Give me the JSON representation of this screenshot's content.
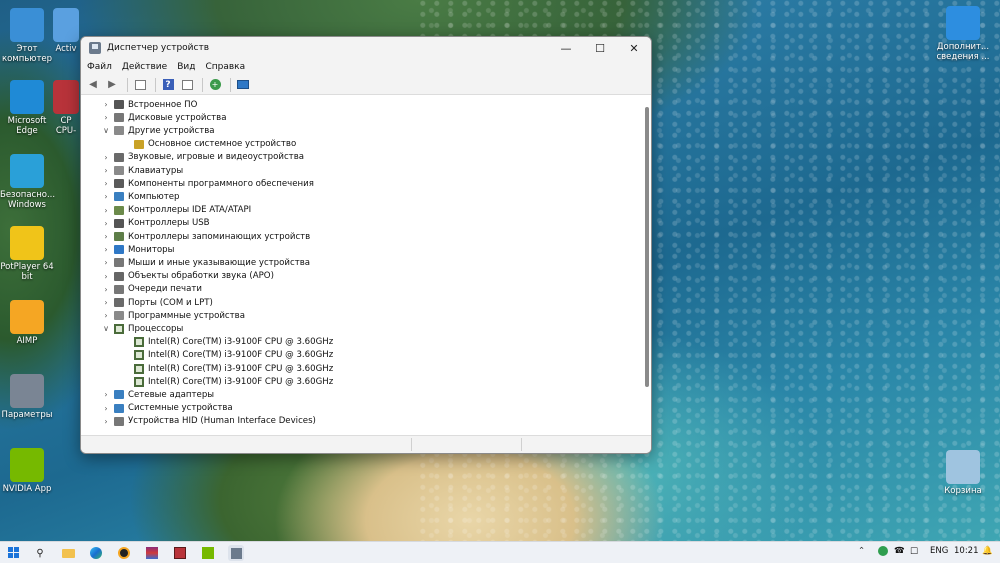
{
  "desktop": {
    "icons_left": [
      {
        "label": "Этот компьютер",
        "icon": "monitor-icon",
        "color": "#3a8fd6"
      },
      {
        "label": "Microsoft Edge",
        "icon": "edge-icon",
        "color": "#1f8ad6"
      },
      {
        "label": "Безопасно... Windows",
        "icon": "shield-icon",
        "color": "#2aa0d8"
      },
      {
        "label": "PotPlayer 64 bit",
        "icon": "potplayer-icon",
        "color": "#f0c419"
      },
      {
        "label": "AIMP",
        "icon": "aimp-icon",
        "color": "#f5a623"
      },
      {
        "label": "Параметры",
        "icon": "gear-icon",
        "color": "#7a8594"
      },
      {
        "label": "NVIDIA App",
        "icon": "nvidia-icon",
        "color": "#76b900"
      }
    ],
    "icons_col2": [
      {
        "label": "Activ",
        "icon": "key-icon"
      },
      {
        "label": "CP CPU-",
        "icon": "cpuz-icon"
      }
    ],
    "icons_right": [
      {
        "label": "Дополнит... сведения ...",
        "icon": "info-image-icon",
        "color": "#2d8ee0"
      },
      {
        "label": "Корзина",
        "icon": "recycle-bin-icon",
        "color": "#9fc4e0"
      }
    ]
  },
  "window": {
    "title": "Диспетчер устройств",
    "controls": {
      "minimize": "—",
      "maximize": "☐",
      "close": "✕"
    },
    "menu": [
      "Файл",
      "Действие",
      "Вид",
      "Справка"
    ],
    "tree": [
      {
        "label": "Встроенное ПО",
        "level": 0,
        "expanded": false,
        "icon": "firmware-icon",
        "color": "#555555"
      },
      {
        "label": "Дисковые устройства",
        "level": 0,
        "expanded": false,
        "icon": "disk-icon",
        "color": "#777777"
      },
      {
        "label": "Другие устройства",
        "level": 0,
        "expanded": true,
        "icon": "unknown-device-icon",
        "color": "#8a8a8a"
      },
      {
        "label": "Основное системное устройство",
        "level": 1,
        "expanded": null,
        "icon": "warning-device-icon",
        "color": "#c9a227"
      },
      {
        "label": "Звуковые, игровые и видеоустройства",
        "level": 0,
        "expanded": false,
        "icon": "speaker-icon",
        "color": "#6a6a6a"
      },
      {
        "label": "Клавиатуры",
        "level": 0,
        "expanded": false,
        "icon": "keyboard-icon",
        "color": "#8a8a8a"
      },
      {
        "label": "Компоненты программного обеспечения",
        "level": 0,
        "expanded": false,
        "icon": "software-component-icon",
        "color": "#5a5a5a"
      },
      {
        "label": "Компьютер",
        "level": 0,
        "expanded": false,
        "icon": "computer-icon",
        "color": "#3a7fc0"
      },
      {
        "label": "Контроллеры IDE ATA/ATAPI",
        "level": 0,
        "expanded": false,
        "icon": "ide-controller-icon",
        "color": "#6b8a4a"
      },
      {
        "label": "Контроллеры USB",
        "level": 0,
        "expanded": false,
        "icon": "usb-icon",
        "color": "#555555"
      },
      {
        "label": "Контроллеры запоминающих устройств",
        "level": 0,
        "expanded": false,
        "icon": "storage-controller-icon",
        "color": "#5e7e48"
      },
      {
        "label": "Мониторы",
        "level": 0,
        "expanded": false,
        "icon": "monitor-icon",
        "color": "#2f78c6"
      },
      {
        "label": "Мыши и иные указывающие устройства",
        "level": 0,
        "expanded": false,
        "icon": "mouse-icon",
        "color": "#777777"
      },
      {
        "label": "Объекты обработки звука (APO)",
        "level": 0,
        "expanded": false,
        "icon": "audio-processing-icon",
        "color": "#666666"
      },
      {
        "label": "Очереди печати",
        "level": 0,
        "expanded": false,
        "icon": "printer-icon",
        "color": "#777777"
      },
      {
        "label": "Порты (COM и LPT)",
        "level": 0,
        "expanded": false,
        "icon": "port-icon",
        "color": "#6a6a6a"
      },
      {
        "label": "Программные устройства",
        "level": 0,
        "expanded": false,
        "icon": "software-device-icon",
        "color": "#8a8a8a"
      },
      {
        "label": "Процессоры",
        "level": 0,
        "expanded": true,
        "icon": "cpu-icon",
        "color": "#4a6b3a"
      },
      {
        "label": "Intel(R) Core(TM) i3-9100F CPU @ 3.60GHz",
        "level": 1,
        "expanded": null,
        "icon": "cpu-icon",
        "color": "#4a6b3a"
      },
      {
        "label": "Intel(R) Core(TM) i3-9100F CPU @ 3.60GHz",
        "level": 1,
        "expanded": null,
        "icon": "cpu-icon",
        "color": "#4a6b3a"
      },
      {
        "label": "Intel(R) Core(TM) i3-9100F CPU @ 3.60GHz",
        "level": 1,
        "expanded": null,
        "icon": "cpu-icon",
        "color": "#4a6b3a"
      },
      {
        "label": "Intel(R) Core(TM) i3-9100F CPU @ 3.60GHz",
        "level": 1,
        "expanded": null,
        "icon": "cpu-icon",
        "color": "#4a6b3a"
      },
      {
        "label": "Сетевые адаптеры",
        "level": 0,
        "expanded": false,
        "icon": "network-adapter-icon",
        "color": "#3a7fc0"
      },
      {
        "label": "Системные устройства",
        "level": 0,
        "expanded": false,
        "icon": "system-device-icon",
        "color": "#3a7fc0"
      },
      {
        "label": "Устройства HID (Human Interface Devices)",
        "level": 0,
        "expanded": false,
        "icon": "hid-icon",
        "color": "#777777"
      }
    ]
  },
  "taskbar": {
    "tray": {
      "lang": "ENG",
      "time": "10:21"
    }
  }
}
